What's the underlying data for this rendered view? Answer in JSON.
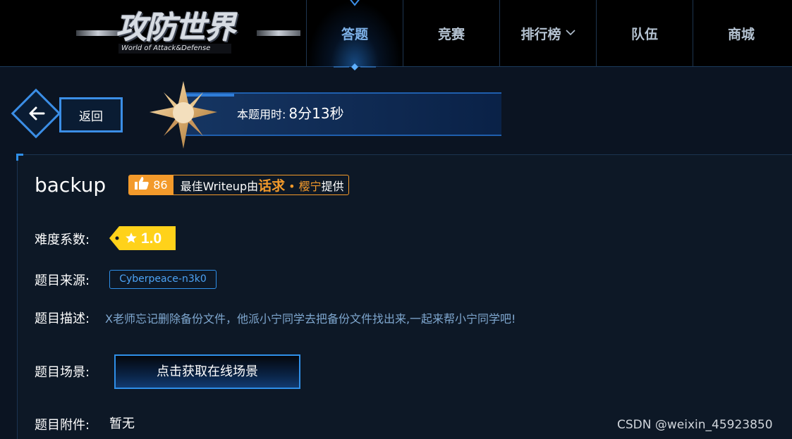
{
  "logo": {
    "title": "攻防世界",
    "subtitle": "World of Attack&Defense"
  },
  "nav": {
    "items": [
      {
        "label": "答题",
        "active": true
      },
      {
        "label": "竞赛"
      },
      {
        "label": "排行榜",
        "dropdown": true
      },
      {
        "label": "队伍"
      },
      {
        "label": "商城"
      }
    ]
  },
  "back": {
    "label": "返回"
  },
  "timer": {
    "label": "本题用时:",
    "value": "8分13秒"
  },
  "task": {
    "title": "backup",
    "likes": "86",
    "writeup_prefix": "最佳Writeup由",
    "writeup_author": "话求",
    "writeup_dot": "•",
    "writeup_team": "樱宁",
    "writeup_suffix": "提供",
    "difficulty_label": "难度系数:",
    "difficulty_value": "1.0",
    "source_label": "题目来源:",
    "source_value": "Cyberpeace-n3k0",
    "desc_label": "题目描述:",
    "desc_value": "X老师忘记删除备份文件，他派小宁同学去把备份文件找出来,一起来帮小宁同学吧!",
    "scene_label": "题目场景:",
    "scene_button": "点击获取在线场景",
    "attach_label": "题目附件:",
    "attach_value": "暂无"
  },
  "watermark": "CSDN @weixin_45923850",
  "colors": {
    "accent": "#2f8fe8",
    "orange": "#f39a2b",
    "gold": "#ffd21a",
    "desc": "#7fa7cf"
  },
  "icons": [
    "back-arrow-icon",
    "thumbs-up-icon",
    "star-icon",
    "chevron-down-icon",
    "compass-star-icon"
  ]
}
